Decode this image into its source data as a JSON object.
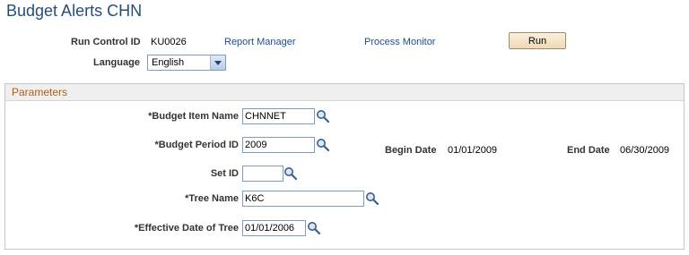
{
  "page": {
    "title": "Budget Alerts CHN"
  },
  "header": {
    "run_control_label": "Run Control ID",
    "run_control_value": "KU0026",
    "report_manager_link": "Report Manager",
    "process_monitor_link": "Process Monitor",
    "run_button": "Run",
    "language_label": "Language",
    "language_value": "English"
  },
  "parameters": {
    "title": "Parameters",
    "budget_item_name": {
      "label": "*Budget Item Name",
      "value": "CHNNET"
    },
    "budget_period_id": {
      "label": "*Budget Period ID",
      "value": "2009"
    },
    "begin_date": {
      "label": "Begin Date",
      "value": "01/01/2009"
    },
    "end_date": {
      "label": "End Date",
      "value": "06/30/2009"
    },
    "set_id": {
      "label": "Set ID",
      "value": ""
    },
    "tree_name": {
      "label": "*Tree Name",
      "value": "K6C"
    },
    "effective_date": {
      "label": "*Effective Date of Tree",
      "value": "01/01/2006"
    }
  },
  "icons": {
    "lookup": "magnifier-icon",
    "dropdown": "chevron-down-icon"
  },
  "colors": {
    "title": "#264d7a",
    "link": "#1a4e8c",
    "group_title": "#b25d11"
  }
}
